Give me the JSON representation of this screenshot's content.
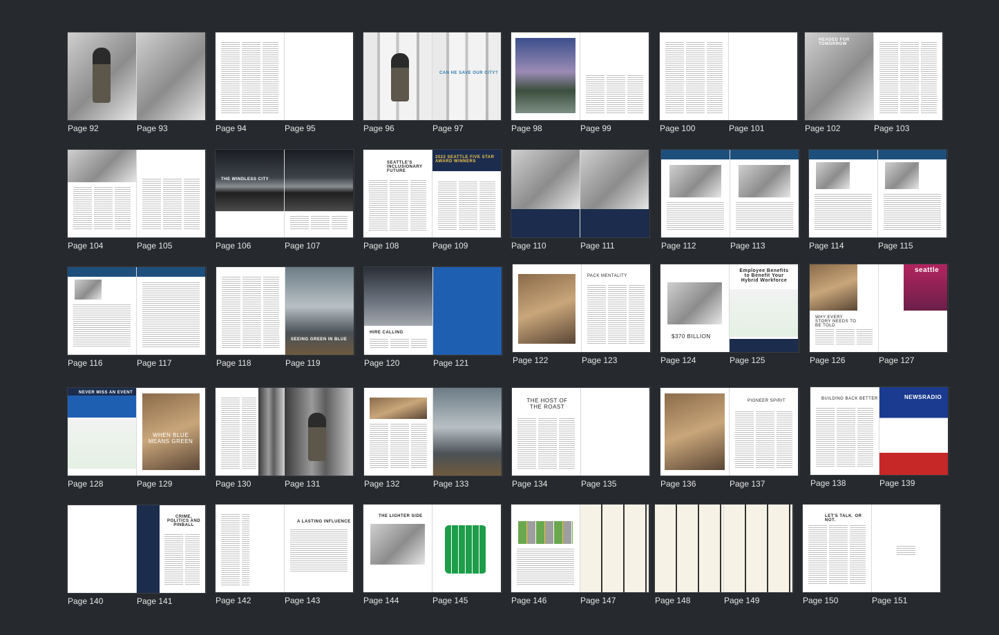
{
  "spreads": [
    {
      "pages": [
        "Page 92",
        "Page 93"
      ]
    },
    {
      "pages": [
        "Page 94",
        "Page 95"
      ]
    },
    {
      "pages": [
        "Page 96",
        "Page 97"
      ],
      "captions": [
        "",
        "CAN HE SAVE OUR CITY?"
      ]
    },
    {
      "pages": [
        "Page 98",
        "Page 99"
      ]
    },
    {
      "pages": [
        "Page 100",
        "Page 101"
      ]
    },
    {
      "pages": [
        "Page 102",
        "Page 103"
      ],
      "captions": [
        "HEADED FOR TOMORROW",
        ""
      ]
    },
    {
      "pages": [
        "Page 104",
        "Page 105"
      ]
    },
    {
      "pages": [
        "Page 106",
        "Page 107"
      ],
      "captions": [
        "THE WINDLESS CITY",
        ""
      ]
    },
    {
      "pages": [
        "Page 108",
        "Page 109"
      ],
      "captions": [
        "SEATTLE'S INCLUSIONARY FUTURE",
        "2022 SEATTLE FIVE STAR AWARD WINNERS"
      ]
    },
    {
      "pages": [
        "Page 110",
        "Page 111"
      ]
    },
    {
      "pages": [
        "Page 112",
        "Page 113"
      ]
    },
    {
      "pages": [
        "Page 114",
        "Page 115"
      ]
    },
    {
      "pages": [
        "Page 116",
        "Page 117"
      ]
    },
    {
      "pages": [
        "Page 118",
        "Page 119"
      ],
      "captions": [
        "",
        "SEEING GREEN IN BLUE"
      ]
    },
    {
      "pages": [
        "Page 120",
        "Page 121"
      ],
      "captions": [
        "HIRE CALLING",
        ""
      ]
    },
    {
      "pages": [
        "Page 122",
        "Page 123"
      ],
      "captions": [
        "",
        "PACK MENTALITY"
      ]
    },
    {
      "pages": [
        "Page 124",
        "Page 125"
      ],
      "captions": [
        "$370 BILLION",
        "Employee Benefits to Benefit Your Hybrid Workforce"
      ]
    },
    {
      "pages": [
        "Page 126",
        "Page 127"
      ],
      "captions": [
        "WHY EVERY STORY NEEDS TO BE TOLD",
        "seattle"
      ]
    },
    {
      "pages": [
        "Page 128",
        "Page 129"
      ],
      "captions": [
        "NEVER MISS AN EVENT",
        "WHEN BLUE MEANS GREEN"
      ]
    },
    {
      "pages": [
        "Page 130",
        "Page 131"
      ]
    },
    {
      "pages": [
        "Page 132",
        "Page 133"
      ]
    },
    {
      "pages": [
        "Page 134",
        "Page 135"
      ],
      "captions": [
        "THE HOST OF THE ROAST",
        ""
      ]
    },
    {
      "pages": [
        "Page 136",
        "Page 137"
      ],
      "captions": [
        "",
        "PIONEER SPIRIT"
      ]
    },
    {
      "pages": [
        "Page 138",
        "Page 139"
      ],
      "captions": [
        "BUILDING BACK BETTER",
        "NEWSRADIO"
      ]
    },
    {
      "pages": [
        "Page 140",
        "Page 141"
      ],
      "captions": [
        "",
        "CRIME, POLITICS AND PINBALL"
      ]
    },
    {
      "pages": [
        "Page 142",
        "Page 143"
      ],
      "captions": [
        "",
        "A LASTING INFLUENCE"
      ]
    },
    {
      "pages": [
        "Page 144",
        "Page 145"
      ],
      "captions": [
        "THE LIGHTER SIDE",
        ""
      ]
    },
    {
      "pages": [
        "Page 146",
        "Page 147"
      ]
    },
    {
      "pages": [
        "Page 148",
        "Page 149"
      ]
    },
    {
      "pages": [
        "Page 150",
        "Page 151"
      ],
      "captions": [
        "LET'S TALK. OR NOT.",
        ""
      ]
    }
  ],
  "colors": {
    "background": "#26292d",
    "label": "#e6e6e6"
  }
}
